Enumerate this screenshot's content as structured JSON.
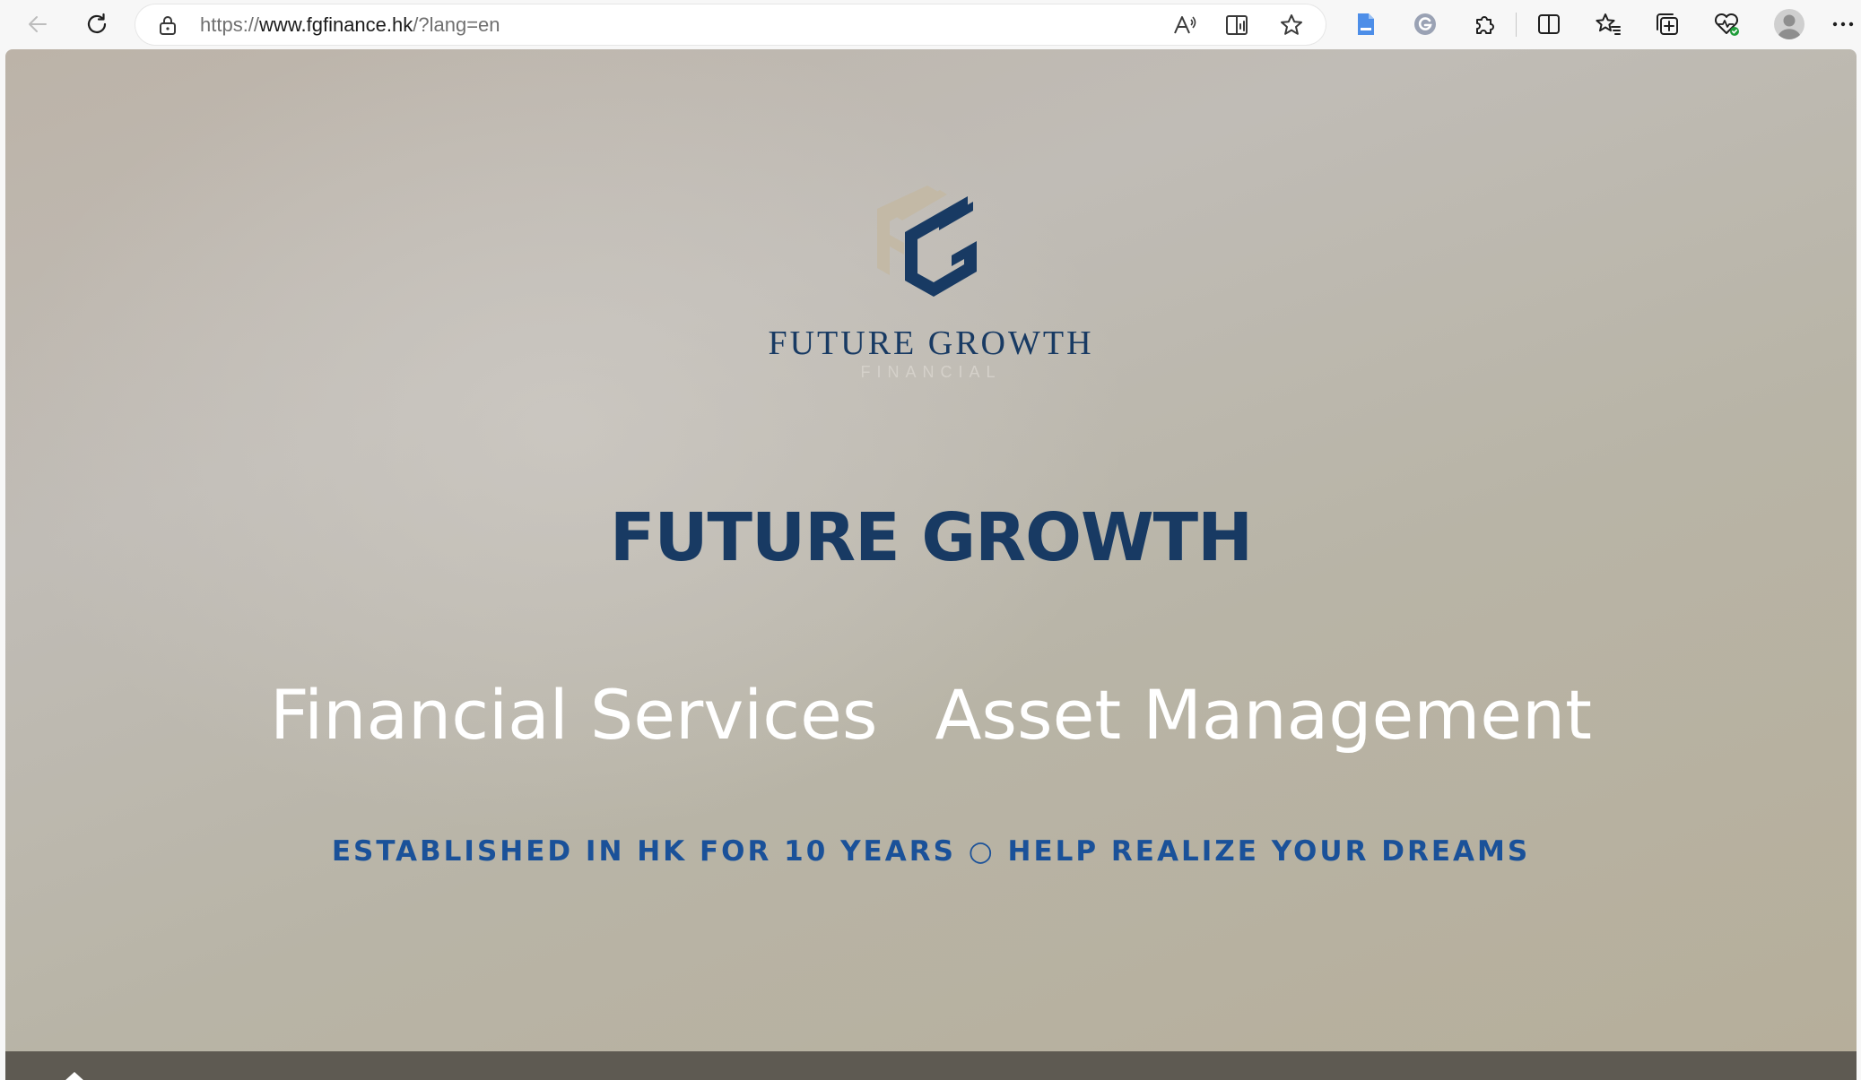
{
  "browser": {
    "url": {
      "protocol": "https://",
      "host": "www.fgfinance.hk",
      "path": "/?lang=en"
    }
  },
  "page": {
    "logo": {
      "wordmark": "FUTURE GROWTH",
      "subtitle": "FINANCIAL",
      "colors": {
        "navy": "#183a63",
        "beige": "#c3b9a6"
      }
    },
    "hero": {
      "title": "FUTURE GROWTH",
      "service_1": "Financial Services",
      "service_2": "Asset Management",
      "tagline": "ESTABLISHED IN HK FOR 10 YEARS ○ HELP REALIZE YOUR DREAMS"
    }
  },
  "icons": [
    "back-icon",
    "refresh-icon",
    "lock-icon",
    "read-aloud-icon",
    "immersive-reader-icon",
    "favorite-star-icon",
    "document-extension-icon",
    "grammarly-icon",
    "extensions-icon",
    "split-screen-icon",
    "favorites-icon",
    "collections-icon",
    "browser-essentials-icon",
    "profile-avatar-icon",
    "more-menu-icon",
    "home-icon"
  ]
}
